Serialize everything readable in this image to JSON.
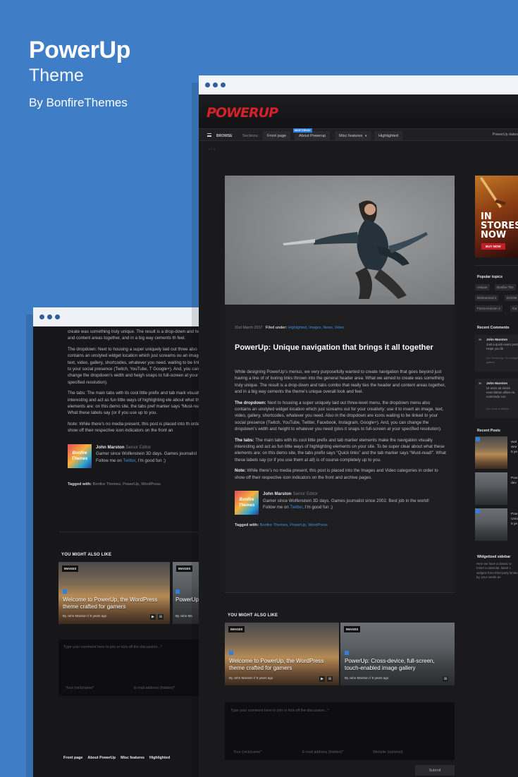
{
  "hero": {
    "title": "PowerUp",
    "subtitle": "Theme",
    "byline": "By BonfireThemes"
  },
  "colors": {
    "background": "#3f7ec7",
    "accent_red": "#d8202b",
    "accent_blue": "#2d7fe0",
    "dark": "#1a1a1d"
  },
  "back_window": {
    "intro_fragment": "create was something truly unique. The result is a drop-down and header and content areas together, and in a big way cements th feel.",
    "dropdown_para": "The dropdown: Next to housing a super uniquely laid out three also contains an unstyled widget location which just screams ou an image, text, video, gallery, shortcodes, whatever you need. waiting to be linked to your social presence (Twitch, YouTube, T Google+). And, you can change the dropdown’s width and heigh snaps to full-screen at your specified resolution).",
    "tabs_para": "The tabs: The main tabs with its cool little prefix and tab mark visually interesting and act as fun little ways of highlighting ele about what these elements are: on this demo site, the tabs pref marker says “Must-read!”. What these labels say (or if you use up to you.",
    "note_para": "Note: While there’s no media present, this post is placed into th order to show off their respective icon indicators on the front an",
    "author_name": "John Marston",
    "author_role": "Senior Editor",
    "author_bio": "Gamer since Wolfenstein 3D days. Games journalist",
    "author_follow_prefix": "Follow me on ",
    "author_follow_link": "Twitter",
    "author_follow_suffix": ", I'm good fun ;)",
    "tagged_label": "Tagged with:",
    "tags": "Bonfire Themes, PowerUp, WordPress",
    "related_heading": "YOU MIGHT ALSO LIKE",
    "card1_tag": "IMAGES",
    "card1_title": "Welcome to PowerUp, the WordPress theme crafted for gamers",
    "card1_meta": "By John Marston // 5 years ago",
    "card2_tag": "IMAGES",
    "card2_title": "PowerUp: touch-en",
    "card2_meta": "By John Ma",
    "comment_placeholder": "Type your comment here to join or kick off the discussion...*",
    "name_field": "Your (nick)name*",
    "email_field": "E-mail address (hidden)*",
    "footer_links": [
      "Front page",
      "About PowerUp",
      "Misc features",
      "Highlighted"
    ]
  },
  "front_window": {
    "logo": "POWERUP",
    "nav": {
      "browse": "BROWSE",
      "sections": "Sections:",
      "front_page": "Front page",
      "about": "About Powerup",
      "misc": "Misc features",
      "highlighted": "Highlighted",
      "must_read": "MUST-READ!",
      "dates": "PowerUp dates"
    },
    "crumb": "‹ › ☆",
    "post_date": "31st March 2017",
    "filed_label": "Filed under:",
    "filed_cats": "Highlighted, Images, News, Video",
    "post_title": "PowerUp: Unique navigation that brings it all together",
    "intro": "While designing PowerUp’s menus, we very purposefully wanted to create navigation that goes beyond just having a line of ol’ boring links thrown into the general header area. What we aimed to create was something truly unique. The result is a drop-down and tabs combo that really ties the header and content areas together, and in a big way cements the theme’s unique overall look and feel.",
    "dropdown_label": "The dropdown:",
    "dropdown_text": " Next to housing a super uniquely laid out three-level menu, the dropdown menu also contains an unstyled widget location which just screams out for your creativity; use it to insert an image, text, video, gallery, shortcodes, whatever you need. Also in the dropdown are icons waiting to be linked to your social presence (Twitch, YouTube, Twitter, Facebook, Instagram, Google+). And, you can change the dropdown’s width and height to whatever you need (plus it snaps to full-screen at your specified resolution).",
    "tabs_label": "The tabs:",
    "tabs_text": " The main tabs with its cool little prefix and tab marker elements make the navigation visually interesting and act as fun little ways of highlighting elements on your site. To be super clear about what these elements are: on this demo site, the tabs prefix says “Quick links” and the tab marker says “Must-read!”. What these labels say (or if you use them at all) is of course completely up to you.",
    "note_label": "Note:",
    "note_text": " While there’s no media present, this post is placed into the Images and Video categories in order to show off their respective icon indicators on the front and archive pages.",
    "author_name": "John Marston",
    "author_role": "Senior Editor",
    "author_bio": "Gamer since Wolfenstein 3D days. Games journalist since 2002. Best job in the world!",
    "author_follow_prefix": "Follow me on ",
    "author_follow_link": "Twitter",
    "author_follow_suffix": ", I'm good fun ;)",
    "avatar_text": "Bonfire Themes",
    "tagged_label": "Tagged with:",
    "tags": "Bonfire Themes, PowerUp, WordPress",
    "related_heading": "YOU MIGHT ALSO LIKE",
    "card1_tag": "IMAGES",
    "card1_title": "Welcome to PowerUp, the WordPress theme crafted for gamers",
    "card1_meta": "By John Marston // 5 years ago",
    "card2_tag": "IMAGES",
    "card2_title": "PowerUp: Cross-device, full-screen, touch-enabled image gallery",
    "card2_meta": "By John Marston // 5 years ago",
    "comment_placeholder": "Type your comment here to join or kick off the discussion...*",
    "name_field": "Your (nick)name*",
    "email_field": "E-mail address (hidden)*",
    "website_field": "Website (optional)",
    "submit": "Submit",
    "sidebar": {
      "ad_line1": "IN",
      "ad_line2": "STORES",
      "ad_line3": "NOW",
      "ad_button": "BUY NOW",
      "popular_heading": "Popular topics",
      "topics": [
        "Arkane",
        "Bonfire The",
        "Dishonored 2",
        "DOOM",
        "Forza Horizon 4",
        "Ga"
      ],
      "comments_heading": "Recent Comments",
      "comment1_name": "John Marston",
      "comment1_body": "Just a quick exam post. Hope you lik",
      "comment1_on": "On: PowerUp: Cro image gallery",
      "comment2_name": "John Marston",
      "comment2_body": "Ut enim ad minim exercitation ullam ea commodo con",
      "comment2_on": "On: God of Warrio",
      "posts_heading": "Recent Posts",
      "post1": "Wel Wor 5 ye",
      "post2": "Pow dev",
      "post3": "Pow Unio 5 ye",
      "widget_heading": "Widgetized sidebar",
      "widget_text": "Here we have a classic w Insert a calendar, latest c widgets from third-party limited by, your needs an"
    }
  }
}
